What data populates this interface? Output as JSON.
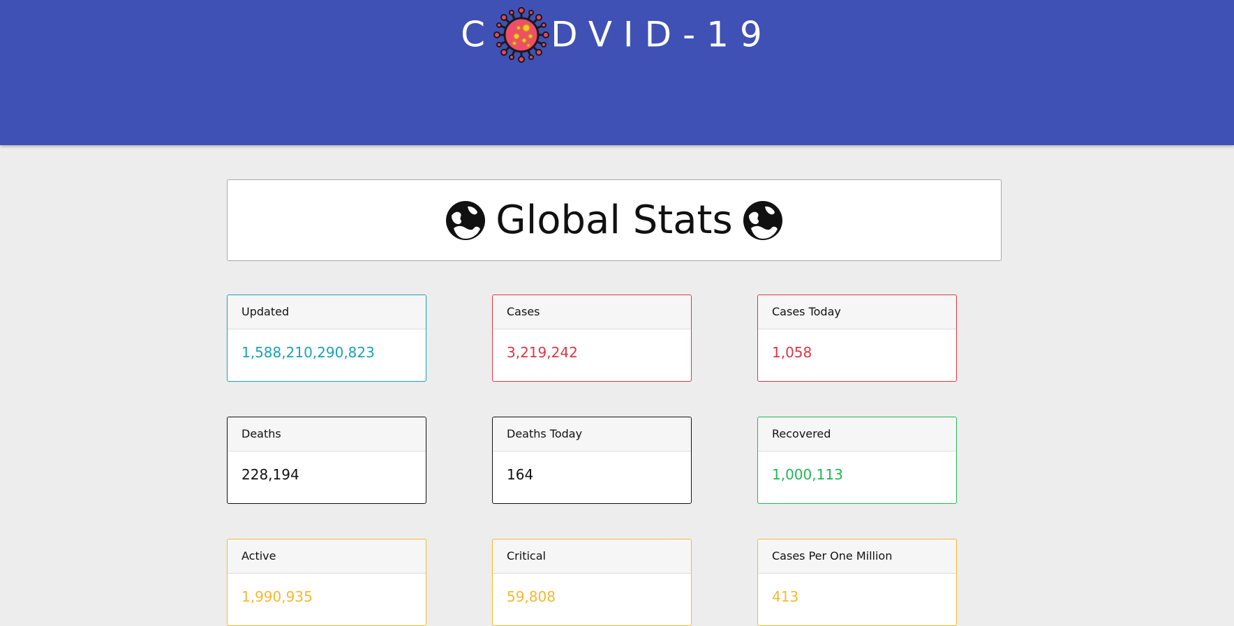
{
  "header": {
    "title_before": "C",
    "title_after": "DVID-19",
    "icon": "virus-icon",
    "background_color": "#3f51b5"
  },
  "global_stats": {
    "title": "Global Stats",
    "icon": "globe-icon"
  },
  "cards": [
    {
      "label": "Updated",
      "value": "1,588,210,290,823",
      "color": "#17a2b8"
    },
    {
      "label": "Cases",
      "value": "3,219,242",
      "color": "#dc3545"
    },
    {
      "label": "Cases Today",
      "value": "1,058",
      "color": "#dc3545"
    },
    {
      "label": "Deaths",
      "value": "228,194",
      "color": "#111111"
    },
    {
      "label": "Deaths Today",
      "value": "164",
      "color": "#111111"
    },
    {
      "label": "Recovered",
      "value": "1,000,113",
      "color": "#1db954"
    },
    {
      "label": "Active",
      "value": "1,990,935",
      "color": "#f5b82e"
    },
    {
      "label": "Critical",
      "value": "59,808",
      "color": "#f5b82e"
    },
    {
      "label": "Cases Per One Million",
      "value": "413",
      "color": "#f5b82e"
    }
  ]
}
